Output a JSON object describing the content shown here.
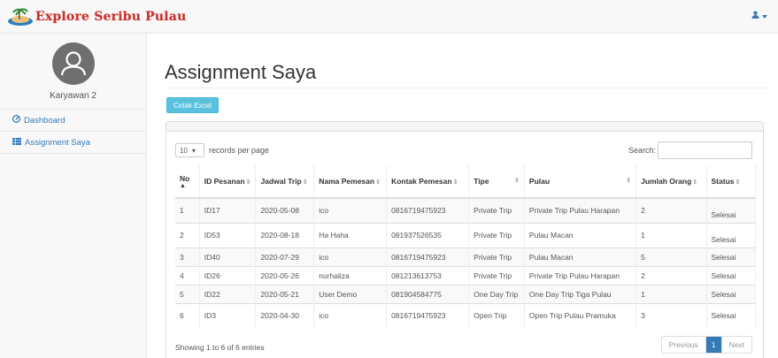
{
  "app": {
    "brand": "Explore Seribu Pulau"
  },
  "sidebar": {
    "user_name": "Karyawan 2",
    "items": [
      {
        "label": "Dashboard",
        "icon": "dashboard-icon"
      },
      {
        "label": "Assignment Saya",
        "icon": "table-icon"
      }
    ]
  },
  "main": {
    "title": "Assignment Saya",
    "excel_button": "Cetak Excel",
    "length_value": "10",
    "length_suffix": "records per page",
    "search_label": "Search:",
    "search_value": "",
    "columns": [
      {
        "top": "No",
        "bottom": "▲"
      },
      {
        "label": "ID Pesanan"
      },
      {
        "label": "Jadwal Trip"
      },
      {
        "label": "Nama Pemesan"
      },
      {
        "label": "Kontak Pemesan"
      },
      {
        "label": "Tipe"
      },
      {
        "label": "Pulau"
      },
      {
        "label": "Jumlah Orang"
      },
      {
        "label": "Status"
      }
    ],
    "rows": [
      [
        "1",
        "ID17",
        "2020-05-08",
        "ico",
        "0816719475923",
        "Private Trip",
        "Private Trip Pulau Harapan",
        "2",
        "Selesai"
      ],
      [
        "2",
        "ID53",
        "2020-08-18",
        "Ha Haha",
        "081937526535",
        "Private Trip",
        "Pulau Macan",
        "1",
        "Selesai"
      ],
      [
        "3",
        "ID40",
        "2020-07-29",
        "ico",
        "0816719475923",
        "Private Trip",
        "Pulau Macan",
        "5",
        "Selesai"
      ],
      [
        "4",
        "ID26",
        "2020-05-26",
        "nurhaliza",
        "081213613753",
        "Private Trip",
        "Private Trip Pulau Harapan",
        "2",
        "Selesai"
      ],
      [
        "5",
        "ID22",
        "2020-05-21",
        "User Demo",
        "081904584775",
        "One Day Trip",
        "One Day Trip Tiga Pulau",
        "1",
        "Selesai"
      ],
      [
        "6",
        "ID3",
        "2020-04-30",
        "ico",
        "0816719475923",
        "Open Trip",
        "Open Trip Pulau Pramuka",
        "3",
        "Selesai"
      ]
    ],
    "info": "Showing 1 to 6 of 6 entries",
    "pagination": {
      "previous": "Previous",
      "current": "1",
      "next": "Next"
    }
  },
  "colors": {
    "accent": "#337ab7",
    "info_button": "#5bc0de",
    "brand_text": "#c9302c"
  }
}
